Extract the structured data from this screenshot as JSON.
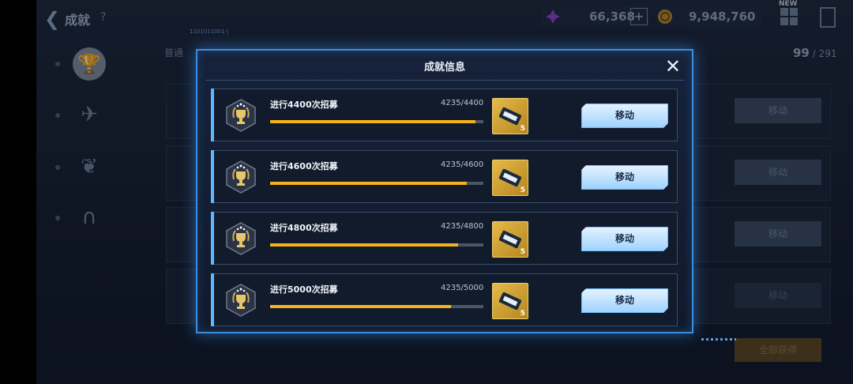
{
  "header": {
    "back_glyph": "❮",
    "title": "成就",
    "help": "?",
    "currency1_value": "66,368",
    "currency1_add": "+",
    "currency2_value": "9,948,760",
    "new_badge": "NEW"
  },
  "id_label": "1101011001-|",
  "tab_label": "普通",
  "progress_count": {
    "current": "99",
    "separator_total": "/ 291"
  },
  "background_buttons": [
    "移动",
    "移动",
    "移动",
    "移动"
  ],
  "claim_all_label": "全部获得",
  "modal": {
    "title": "成就信息",
    "close_glyph": "✕",
    "rows": [
      {
        "name": "进行4400次招募",
        "progress": "4235/4400",
        "fraction": 0.9625,
        "reward_qty": "5",
        "button": "移动"
      },
      {
        "name": "进行4600次招募",
        "progress": "4235/4600",
        "fraction": 0.9207,
        "reward_qty": "5",
        "button": "移动"
      },
      {
        "name": "进行4800次招募",
        "progress": "4235/4800",
        "fraction": 0.8823,
        "reward_qty": "5",
        "button": "移动"
      },
      {
        "name": "进行5000次招募",
        "progress": "4235/5000",
        "fraction": 0.847,
        "reward_qty": "5",
        "button": "移动"
      }
    ]
  },
  "colors": {
    "accent": "#3a8ee0",
    "progress": "#f4b21b",
    "reward_gold": "#e7b948",
    "button_light": "#cfe9ff"
  }
}
